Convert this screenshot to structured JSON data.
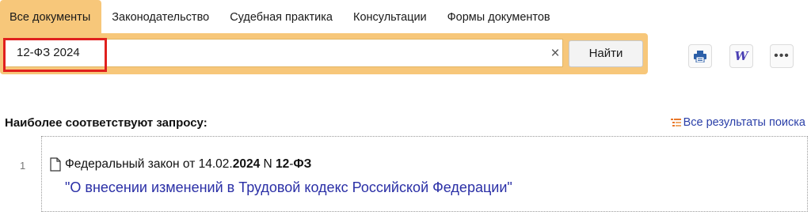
{
  "tabs": [
    {
      "label": "Все документы",
      "active": true
    },
    {
      "label": "Законодательство",
      "active": false
    },
    {
      "label": "Судебная практика",
      "active": false
    },
    {
      "label": "Консультации",
      "active": false
    },
    {
      "label": "Формы документов",
      "active": false
    }
  ],
  "search": {
    "query": "12-ФЗ 2024",
    "clear_symbol": "×",
    "find_label": "Найти"
  },
  "toolbar": {
    "print_icon": "printer-icon",
    "word_icon": "word-export-icon",
    "word_glyph": "W",
    "more_icon": "more-icon",
    "more_glyph": "•••"
  },
  "results": {
    "heading": "Наиболее соответствуют запросу:",
    "all_results_label": "Все результаты поиска",
    "items": [
      {
        "number": "1",
        "title_prefix": "Федеральный закон от 14.02.",
        "title_year": "2024",
        "title_mid": " N ",
        "title_num": "12",
        "title_dash": "-",
        "title_fz": "ФЗ",
        "subtitle": "\"О внесении изменений в Трудовой кодекс Российской Федерации\""
      }
    ]
  },
  "colors": {
    "tab_active": "#f7c77a",
    "highlight": "#e0201e",
    "link": "#2a3fa8"
  }
}
